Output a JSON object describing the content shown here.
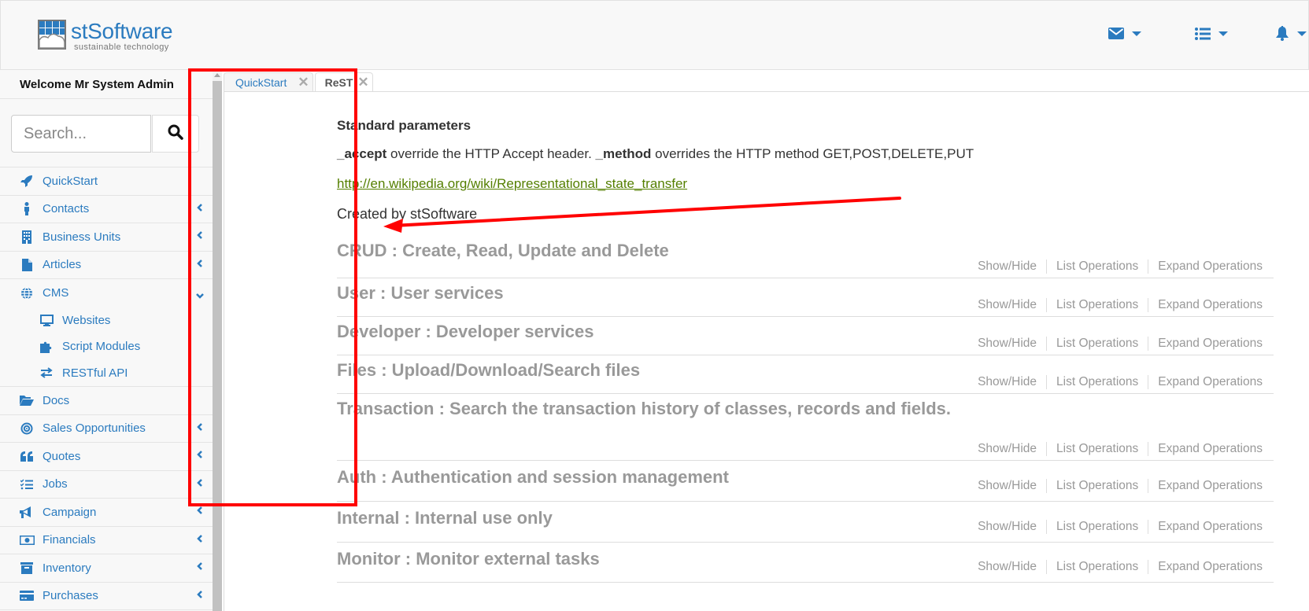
{
  "header": {
    "logo_name": "stSoftware",
    "logo_tagline": "sustainable technology",
    "nav_icons": [
      "envelope-icon",
      "list-icon",
      "bell-icon"
    ]
  },
  "sidebar": {
    "welcome": "Welcome Mr System Admin",
    "search_placeholder": "Search...",
    "items": [
      {
        "label": "QuickStart",
        "icon": "rocket-icon",
        "chevron": "none"
      },
      {
        "label": "Contacts",
        "icon": "person-icon",
        "chevron": "left"
      },
      {
        "label": "Business Units",
        "icon": "building-icon",
        "chevron": "left"
      },
      {
        "label": "Articles",
        "icon": "file-icon",
        "chevron": "left"
      },
      {
        "label": "CMS",
        "icon": "globe-icon",
        "chevron": "down",
        "children": [
          {
            "label": "Websites",
            "icon": "desktop-icon"
          },
          {
            "label": "Script Modules",
            "icon": "puzzle-icon"
          },
          {
            "label": "RESTful API",
            "icon": "exchange-icon"
          }
        ]
      },
      {
        "label": "Docs",
        "icon": "folder-open-icon",
        "chevron": "none"
      },
      {
        "label": "Sales Opportunities",
        "icon": "bullseye-icon",
        "chevron": "left"
      },
      {
        "label": "Quotes",
        "icon": "quote-icon",
        "chevron": "left"
      },
      {
        "label": "Jobs",
        "icon": "tasks-icon",
        "chevron": "left"
      },
      {
        "label": "Campaign",
        "icon": "bullhorn-icon",
        "chevron": "left"
      },
      {
        "label": "Financials",
        "icon": "money-icon",
        "chevron": "left"
      },
      {
        "label": "Inventory",
        "icon": "archive-icon",
        "chevron": "left"
      },
      {
        "label": "Purchases",
        "icon": "credit-card-icon",
        "chevron": "left"
      }
    ]
  },
  "tabs": [
    {
      "label": "QuickStart",
      "active": false
    },
    {
      "label": "ReST",
      "active": true
    }
  ],
  "content": {
    "std_title": "Standard parameters",
    "param1_name": "_accept",
    "param1_desc": " override the HTTP Accept header. ",
    "param2_name": "_method",
    "param2_desc": " overrides the HTTP method GET,POST,DELETE,PUT",
    "link": "http://en.wikipedia.org/wiki/Representational_state_transfer",
    "created_by": "Created by stSoftware",
    "op_labels": {
      "show_hide": "Show/Hide",
      "list": "List Operations",
      "expand": "Expand Operations"
    },
    "resources": [
      {
        "title": "CRUD : Create, Read, Update and Delete"
      },
      {
        "title": "User : User services"
      },
      {
        "title": "Developer : Developer services"
      },
      {
        "title": "Files : Upload/Download/Search files"
      },
      {
        "title": "Transaction : Search the transaction history of classes, records and fields."
      },
      {
        "title": "Auth : Authentication and session management"
      },
      {
        "title": "Internal : Internal use only"
      },
      {
        "title": "Monitor : Monitor external tasks"
      }
    ]
  },
  "colors": {
    "brand": "#2b7bbf",
    "link": "#547f00",
    "annotation": "#ff0000",
    "muted": "#999999"
  }
}
